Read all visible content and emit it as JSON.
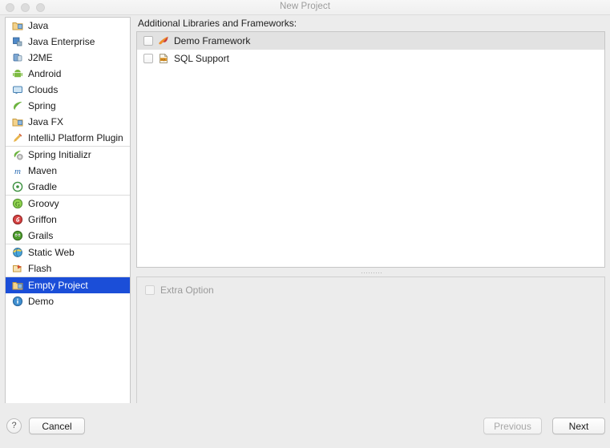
{
  "window": {
    "title": "New Project",
    "traffic_lights": [
      "close-button",
      "minimize-button",
      "zoom-button"
    ]
  },
  "sidebar": {
    "groups": [
      {
        "items": [
          {
            "label": "Java",
            "icon": "java-folder-icon",
            "selected": false
          },
          {
            "label": "Java Enterprise",
            "icon": "java-enterprise-icon",
            "selected": false
          },
          {
            "label": "J2ME",
            "icon": "j2me-icon",
            "selected": false
          },
          {
            "label": "Android",
            "icon": "android-icon",
            "selected": false
          },
          {
            "label": "Clouds",
            "icon": "clouds-icon",
            "selected": false
          },
          {
            "label": "Spring",
            "icon": "spring-leaf-icon",
            "selected": false
          },
          {
            "label": "Java FX",
            "icon": "javafx-folder-icon",
            "selected": false
          },
          {
            "label": "IntelliJ Platform Plugin",
            "icon": "plugin-icon",
            "selected": false
          }
        ]
      },
      {
        "items": [
          {
            "label": "Spring Initializr",
            "icon": "spring-initializr-icon",
            "selected": false
          },
          {
            "label": "Maven",
            "icon": "maven-icon",
            "selected": false
          },
          {
            "label": "Gradle",
            "icon": "gradle-icon",
            "selected": false
          }
        ]
      },
      {
        "items": [
          {
            "label": "Groovy",
            "icon": "groovy-icon",
            "selected": false
          },
          {
            "label": "Griffon",
            "icon": "griffon-icon",
            "selected": false
          },
          {
            "label": "Grails",
            "icon": "grails-icon",
            "selected": false
          }
        ]
      },
      {
        "items": [
          {
            "label": "Static Web",
            "icon": "static-web-icon",
            "selected": false
          },
          {
            "label": "Flash",
            "icon": "flash-icon",
            "selected": false
          }
        ]
      },
      {
        "items": [
          {
            "label": "Empty Project",
            "icon": "empty-project-folder-icon",
            "selected": true
          },
          {
            "label": "Demo",
            "icon": "demo-info-icon",
            "selected": false
          }
        ]
      }
    ]
  },
  "main": {
    "frameworks_label": "Additional Libraries and Frameworks:",
    "frameworks": [
      {
        "label": "Demo Framework",
        "icon": "demo-framework-icon",
        "checked": false,
        "highlighted": true
      },
      {
        "label": "SQL Support",
        "icon": "sql-support-icon",
        "checked": false,
        "highlighted": false
      }
    ],
    "extra": {
      "label": "Extra Option",
      "checked": false,
      "disabled": true
    }
  },
  "footer": {
    "help_label": "?",
    "cancel_label": "Cancel",
    "previous_label": "Previous",
    "next_label": "Next",
    "previous_disabled": true,
    "next_disabled": false
  },
  "colors": {
    "selection_blue": "#1b4ed8",
    "window_background": "#ececec",
    "panel_background": "#ffffff",
    "title_text": "#9b9b9b",
    "row_highlight": "#e2e2e2"
  }
}
